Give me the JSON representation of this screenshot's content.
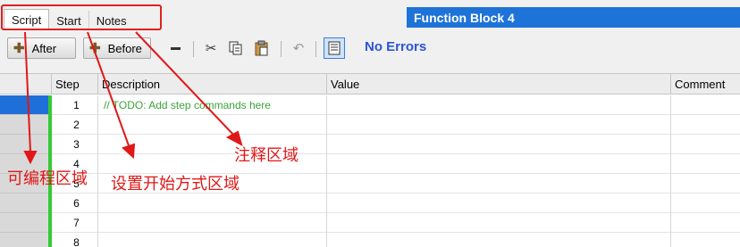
{
  "tabs": [
    {
      "label": "Script",
      "active": true
    },
    {
      "label": "Start",
      "active": false
    },
    {
      "label": "Notes",
      "active": false
    }
  ],
  "block_title": "Function Block 4",
  "toolbar": {
    "after_label": "After",
    "before_label": "Before",
    "status": "No Errors",
    "icons": [
      "remove-icon",
      "cut-icon",
      "copy-icon",
      "paste-icon",
      "undo-icon",
      "script-view-icon"
    ]
  },
  "grid": {
    "columns": [
      "Step",
      "Description",
      "Value",
      "Comment"
    ],
    "rows": [
      {
        "step": "1",
        "description": "// TODO: Add step commands here",
        "selected": true
      },
      {
        "step": "2",
        "description": ""
      },
      {
        "step": "3",
        "description": ""
      },
      {
        "step": "4",
        "description": ""
      },
      {
        "step": "5",
        "description": ""
      },
      {
        "step": "6",
        "description": ""
      },
      {
        "step": "7",
        "description": ""
      },
      {
        "step": "8",
        "description": ""
      }
    ]
  },
  "annotations": {
    "programmable_area": "可编程区域",
    "start_mode_area": "设置开始方式区域",
    "notes_area": "注释区域"
  },
  "colors": {
    "annotation": "#e01818",
    "title_bar": "#1e73d8",
    "status": "#2b55d6",
    "step_marker": "#35c935"
  }
}
